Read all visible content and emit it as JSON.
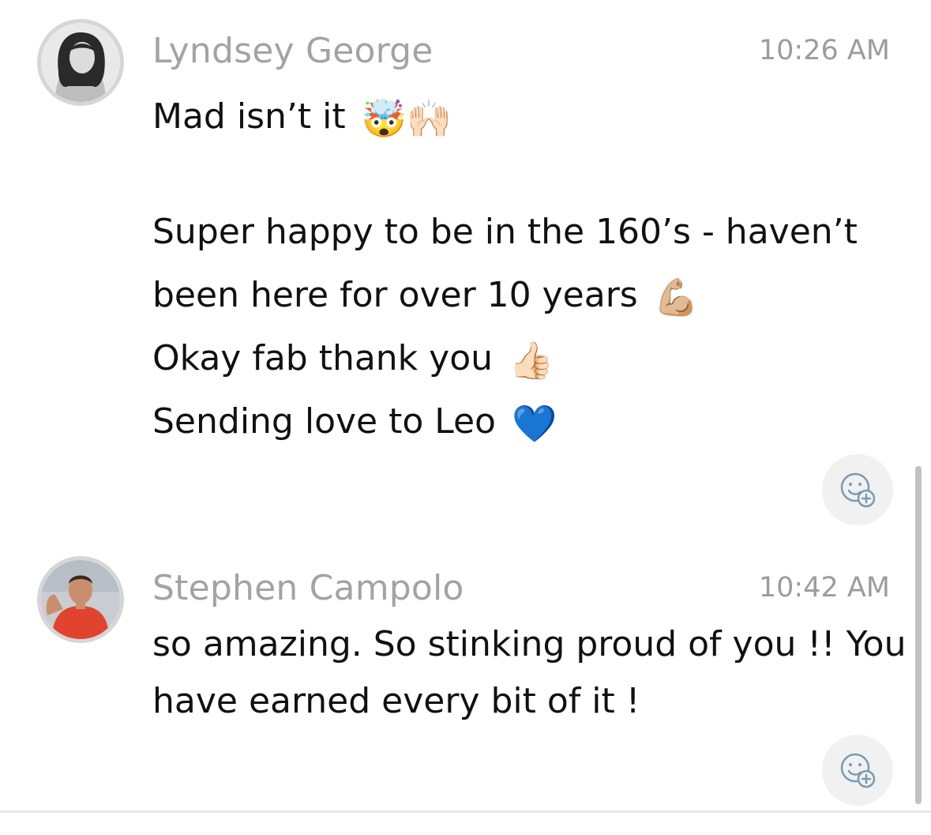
{
  "messages": [
    {
      "sender": "Lyndsey George",
      "time": "10:26 AM",
      "lines": [
        {
          "text": "Mad isn’t it",
          "emoji": "🤯🙌🏻"
        },
        {
          "text": "",
          "emoji": ""
        },
        {
          "text": "Super happy to be in the 160’s - haven’t",
          "emoji": ""
        },
        {
          "text": "been here for over 10 years",
          "emoji": "💪🏼"
        },
        {
          "text": "Okay fab thank you",
          "emoji": "👍🏻"
        },
        {
          "text": "Sending love to Leo",
          "emoji": "💙"
        }
      ],
      "avatar_icon": "avatar-photo",
      "reaction_icon": "add-reaction-icon"
    },
    {
      "sender": "Stephen Campolo",
      "time": "10:42 AM",
      "lines": [
        {
          "text": "so amazing. So stinking proud of you !! You",
          "emoji": ""
        },
        {
          "text": "have earned every bit of it !",
          "emoji": ""
        }
      ],
      "avatar_icon": "avatar-photo",
      "reaction_icon": "add-reaction-icon"
    }
  ],
  "colors": {
    "sender": "#a3a3a3",
    "timestamp": "#9c9c9c",
    "text": "#111111",
    "reaction_bg": "#f1f1f1",
    "icon": "#7a9bb0"
  }
}
